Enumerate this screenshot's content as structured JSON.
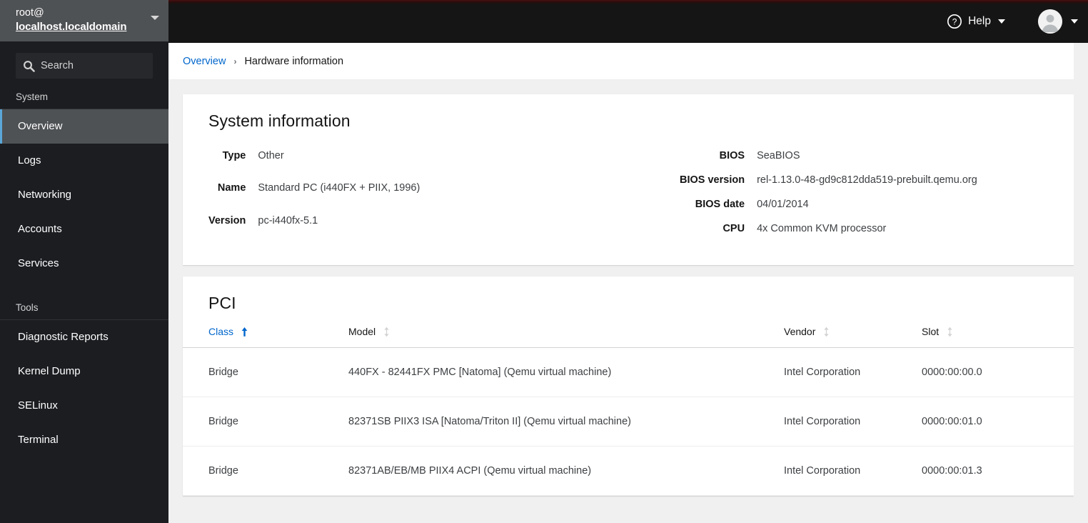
{
  "sidebar": {
    "host": {
      "user": "root@",
      "hostname": "localhost.localdomain"
    },
    "search": {
      "placeholder": "Search",
      "value": ""
    },
    "groups": [
      {
        "label": "System",
        "items": [
          {
            "label": "Overview",
            "active": true
          },
          {
            "label": "Logs",
            "active": false
          },
          {
            "label": "Networking",
            "active": false
          },
          {
            "label": "Accounts",
            "active": false
          },
          {
            "label": "Services",
            "active": false
          }
        ]
      },
      {
        "label": "Tools",
        "items": [
          {
            "label": "Diagnostic Reports",
            "active": false
          },
          {
            "label": "Kernel Dump",
            "active": false
          },
          {
            "label": "SELinux",
            "active": false
          },
          {
            "label": "Terminal",
            "active": false
          }
        ]
      }
    ]
  },
  "topbar": {
    "help_label": "Help",
    "help_icon": "question-circle-icon",
    "avatar_icon": "user-avatar-icon",
    "accent_color": "#4a1010",
    "background_color": "#151515"
  },
  "breadcrumb": {
    "parent": "Overview",
    "separator": "›",
    "current": "Hardware information",
    "link_color": "#0066cc"
  },
  "system_information": {
    "title": "System information",
    "left": [
      {
        "label": "Type",
        "value": "Other"
      },
      {
        "label": "Name",
        "value": "Standard PC (i440FX + PIIX, 1996)"
      },
      {
        "label": "Version",
        "value": "pc-i440fx-5.1"
      }
    ],
    "right": [
      {
        "label": "BIOS",
        "value": "SeaBIOS"
      },
      {
        "label": "BIOS version",
        "value": "rel-1.13.0-48-gd9c812dda519-prebuilt.qemu.org"
      },
      {
        "label": "BIOS date",
        "value": "04/01/2014"
      },
      {
        "label": "CPU",
        "value": "4x Common KVM processor"
      }
    ]
  },
  "pci": {
    "title": "PCI",
    "columns": [
      {
        "label": "Class",
        "sorted": true,
        "direction": "asc",
        "icon": "sort-asc-icon"
      },
      {
        "label": "Model",
        "sorted": false,
        "direction": "none",
        "icon": "sort-icon"
      },
      {
        "label": "Vendor",
        "sorted": false,
        "direction": "none",
        "icon": "sort-icon"
      },
      {
        "label": "Slot",
        "sorted": false,
        "direction": "none",
        "icon": "sort-icon"
      }
    ],
    "rows": [
      {
        "class": "Bridge",
        "model": "440FX - 82441FX PMC [Natoma] (Qemu virtual machine)",
        "vendor": "Intel Corporation",
        "slot": "0000:00:00.0"
      },
      {
        "class": "Bridge",
        "model": "82371SB PIIX3 ISA [Natoma/Triton II] (Qemu virtual machine)",
        "vendor": "Intel Corporation",
        "slot": "0000:00:01.0"
      },
      {
        "class": "Bridge",
        "model": "82371AB/EB/MB PIIX4 ACPI (Qemu virtual machine)",
        "vendor": "Intel Corporation",
        "slot": "0000:00:01.3"
      }
    ]
  }
}
